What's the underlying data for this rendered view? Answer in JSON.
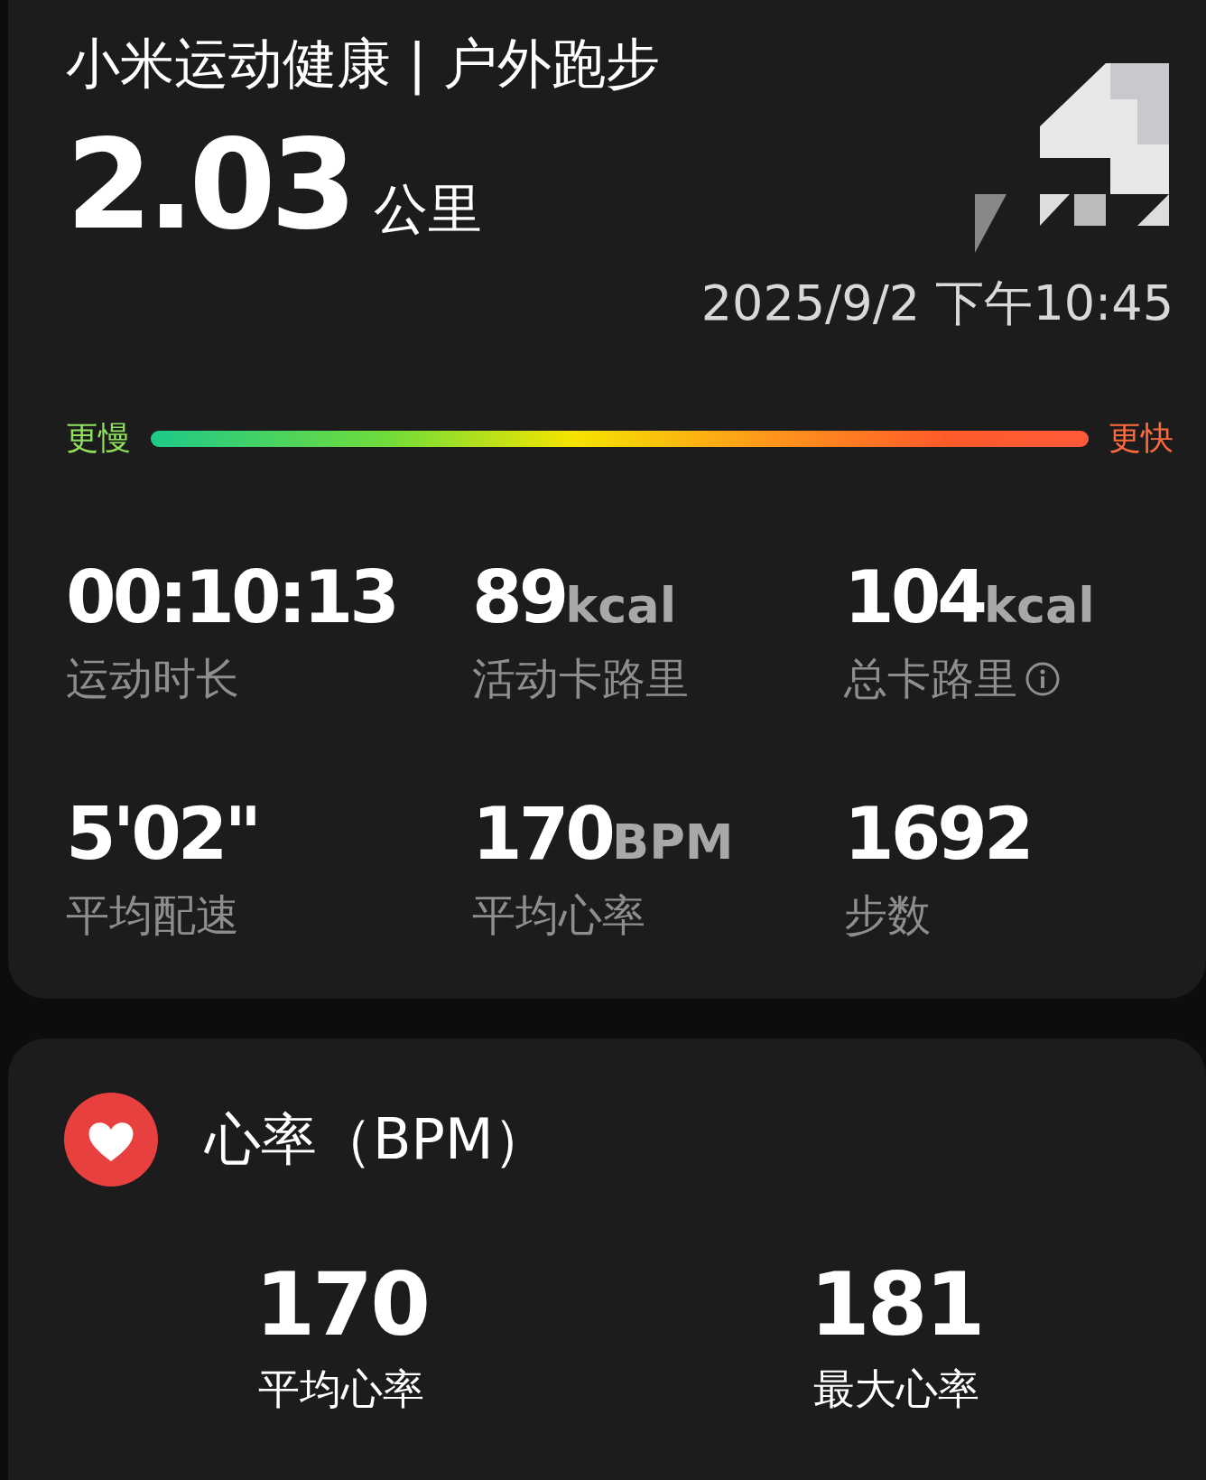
{
  "header": {
    "title": "小米运动健康 | 户外跑步",
    "distance": "2.03",
    "distance_unit": "公里",
    "datetime": "2025/9/2 下午10:45"
  },
  "pace_scale": {
    "slow_label": "更慢",
    "fast_label": "更快"
  },
  "stats": [
    {
      "value": "00:10:13",
      "label": "运动时长",
      "info": false
    },
    {
      "value": "89",
      "unit": "kcal",
      "label": "活动卡路里",
      "info": false
    },
    {
      "value": "104",
      "unit": "kcal",
      "label": "总卡路里",
      "info": true
    },
    {
      "value": "5'02\"",
      "label": "平均配速",
      "info": false
    },
    {
      "value": "170",
      "unit": "BPM",
      "label": "平均心率",
      "info": false
    },
    {
      "value": "1692",
      "label": "步数",
      "info": false
    }
  ],
  "heart_rate": {
    "title": "心率（BPM）",
    "items": [
      {
        "value": "170",
        "label": "平均心率"
      },
      {
        "value": "181",
        "label": "最大心率"
      }
    ]
  }
}
